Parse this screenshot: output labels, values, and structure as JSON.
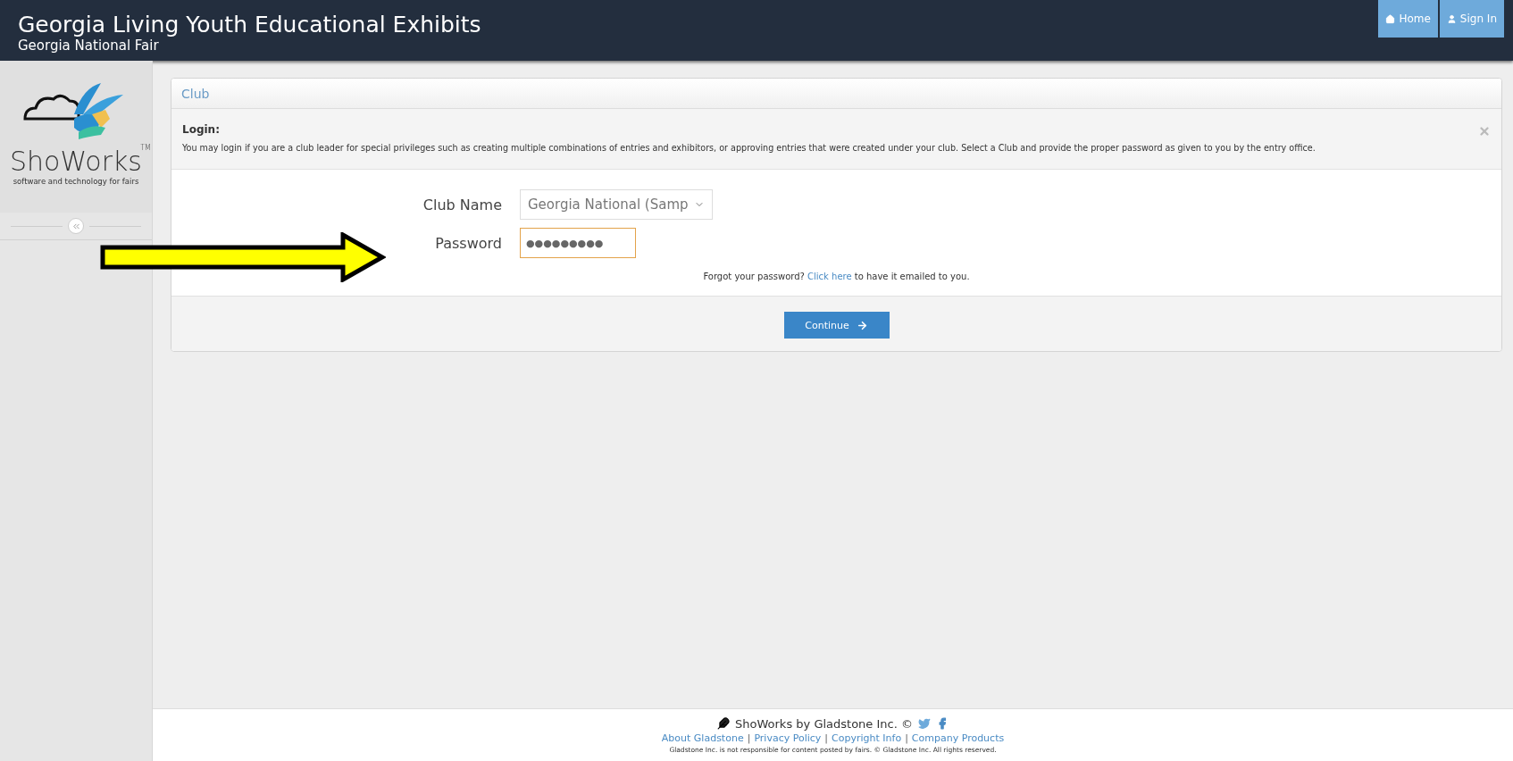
{
  "header": {
    "title": "Georgia Living Youth Educational Exhibits",
    "subtitle": "Georgia National Fair",
    "nav": [
      {
        "kind": "home",
        "label": "Home"
      },
      {
        "kind": "user",
        "label": "Sign In"
      }
    ]
  },
  "sidebar": {
    "logo_text": "ShoWorks",
    "trademark": "TM",
    "tagline": "software and technology for fairs"
  },
  "panel": {
    "title": "Club",
    "alert": {
      "heading": "Login:",
      "text": "You may login if you are a club leader for special privileges such as creating multiple combinations of entries and exhibitors, or approving entries that were created under your club. Select a Club and provide the proper password as given to you by the entry office."
    },
    "fields": [
      {
        "kind": "select",
        "label": "Club Name",
        "value": "Georgia National (Samp",
        "focused": false
      },
      {
        "kind": "password",
        "label": "Password",
        "value": "●●●●●●●●●",
        "focused": true
      }
    ],
    "forgot": {
      "before": "Forgot your password?",
      "link": "Click here",
      "after": "to have it emailed to you."
    },
    "button": "Continue"
  },
  "footer": {
    "brand": "ShoWorks by Gladstone Inc. ©",
    "links": [
      "About Gladstone",
      "Privacy Policy",
      "Copyright Info",
      "Company Products"
    ],
    "separator": "|",
    "disclaimer": "Gladstone Inc. is not responsible for content posted by fairs. © Gladstone Inc. All rights reserved."
  }
}
